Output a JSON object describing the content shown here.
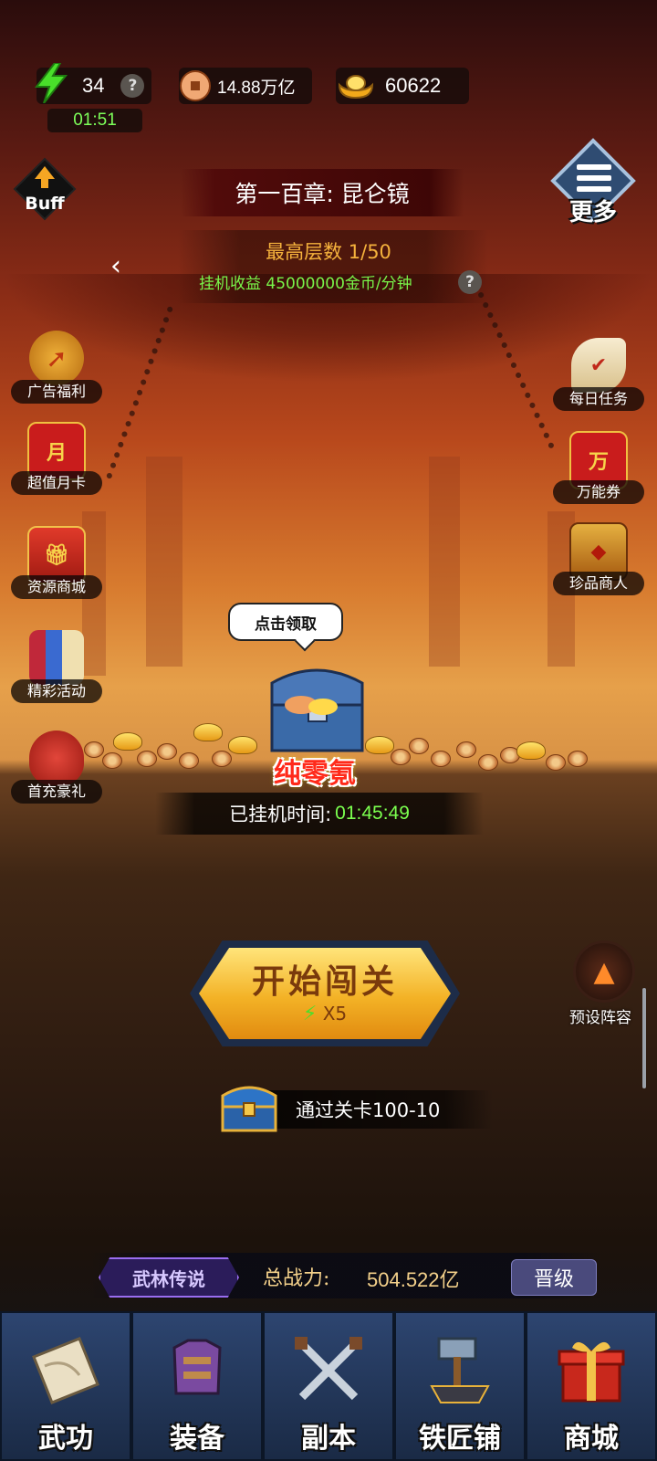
{
  "resources": {
    "energy": {
      "icon": "lightning-bolt-icon",
      "value": "34",
      "timer": "01:51",
      "help": "?"
    },
    "copper": {
      "icon": "copper-coin-icon",
      "value": "14.88万亿"
    },
    "gold": {
      "icon": "gold-ingot-icon",
      "value": "60622"
    }
  },
  "buff_button": {
    "label": "Buff"
  },
  "more_button": {
    "label": "更多"
  },
  "chapter": {
    "title": "第一百章: 昆仑镜",
    "max_floor": "最高层数 1/50",
    "idle_income": "挂机收益 45000000金币/分钟",
    "help": "?"
  },
  "left_menu": [
    {
      "label": "广告福利",
      "icon": "ad-reward-icon"
    },
    {
      "label": "超值月卡",
      "icon": "month-card-icon",
      "glyph": "月"
    },
    {
      "label": "资源商城",
      "icon": "gift-box-icon"
    },
    {
      "label": "精彩活动",
      "icon": "scroll-books-icon"
    },
    {
      "label": "首充豪礼",
      "icon": "money-bag-icon"
    }
  ],
  "right_menu": [
    {
      "label": "每日任务",
      "icon": "scroll-icon"
    },
    {
      "label": "万能券",
      "icon": "voucher-icon",
      "glyph": "万"
    },
    {
      "label": "珍品商人",
      "icon": "treasure-chest-icon"
    }
  ],
  "idle_reward": {
    "bubble": "点击领取",
    "pure_label": "纯零氪",
    "idle_time_label": "已挂机时间:",
    "idle_time_value": "01:45:49"
  },
  "start_button": {
    "label": "开始闯关",
    "cost": "X5"
  },
  "preset_lineup": {
    "label": "预设阵容"
  },
  "stage_goal": {
    "text": "通过关卡100-10"
  },
  "power": {
    "badge": "武林传说",
    "label": "总战力:",
    "value": "504.522亿",
    "promote": "晋级"
  },
  "bottom_nav": [
    {
      "label": "武功",
      "icon": "martial-scroll-icon"
    },
    {
      "label": "装备",
      "icon": "armor-icon"
    },
    {
      "label": "副本",
      "icon": "crossed-swords-icon"
    },
    {
      "label": "铁匠铺",
      "icon": "hammer-anvil-icon"
    },
    {
      "label": "商城",
      "icon": "gift-shop-icon"
    }
  ]
}
